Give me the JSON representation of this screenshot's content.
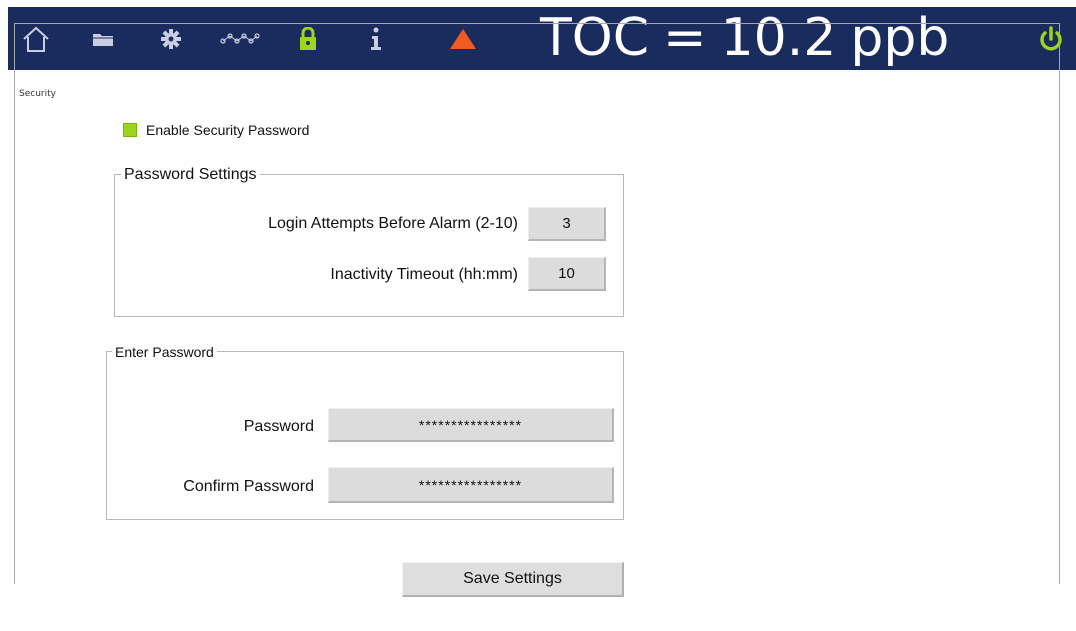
{
  "topbar": {
    "icons": [
      "home-icon",
      "folder-icon",
      "gear-icon",
      "trend-icon",
      "lock-icon",
      "info-icon",
      "alarm-icon",
      "power-icon"
    ],
    "toc_label": "TOC",
    "toc_equals": "=",
    "toc_value": "10.2",
    "toc_unit": "ppb",
    "colors": {
      "bar": "#1a2b5e",
      "lock": "#9bd61a",
      "alarm": "#f15a22",
      "power": "#9bd61a",
      "icon": "#c9cfe0"
    }
  },
  "security": {
    "title": "Security",
    "enable_label": "Enable Security Password",
    "enable_checked": true,
    "password_settings": {
      "title": "Password Settings",
      "login_attempts_label": "Login Attempts Before Alarm (2-10)",
      "login_attempts_value": "3",
      "inactivity_label": "Inactivity Timeout (hh:mm)",
      "inactivity_value": "10"
    },
    "enter_password": {
      "title": "Enter Password",
      "password_label": "Password",
      "password_value": "****************",
      "confirm_label": "Confirm Password",
      "confirm_value": "****************"
    },
    "save_label": "Save Settings"
  }
}
